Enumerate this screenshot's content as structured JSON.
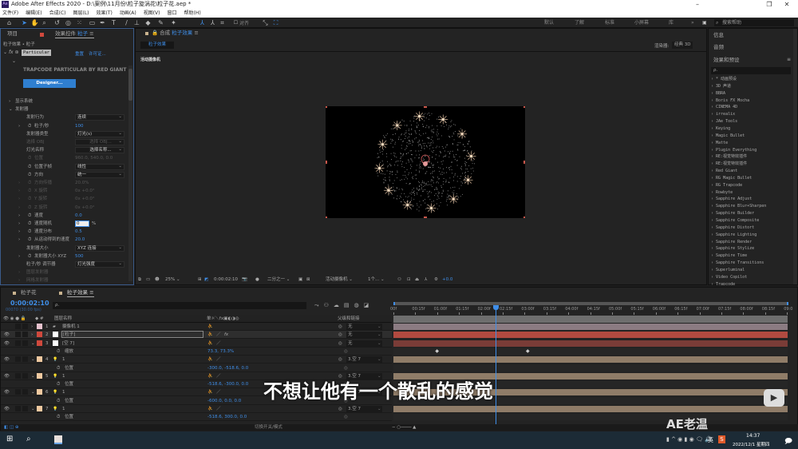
{
  "window": {
    "title": "Adobe After Effects 2020 - D:\\案例\\11月份\\粒子旋涡花\\粒子花.aep *",
    "app_icon": "Ae"
  },
  "menu": [
    "文件(F)",
    "编辑(E)",
    "合成(C)",
    "图层(L)",
    "效果(T)",
    "动画(A)",
    "视图(V)",
    "窗口",
    "帮助(H)"
  ],
  "toolbar": {
    "snap_label": "对齐",
    "workspaces": [
      "默认",
      "了解",
      "标准",
      "小屏幕",
      "库"
    ],
    "more": "»",
    "search_placeholder": "搜索帮助"
  },
  "left_panel": {
    "tab_project": "项目",
    "tab_effects": "效果控件",
    "tab_effects_layer": "粒子",
    "breadcrumb": "粒子效果 • 粒子",
    "effect_name": "Particular",
    "reset": "重置",
    "license": "许可证...",
    "banner": "TRAPCODE PARTICULAR BY RED GIANT",
    "designer": "Designer...",
    "rows": [
      {
        "label": "显示系统",
        "indent": 1,
        "twirl": "›"
      },
      {
        "label": "发射器",
        "indent": 1,
        "twirl": "⌄"
      },
      {
        "label": "发射行为",
        "indent": 2,
        "select": "连续"
      },
      {
        "label": "粒子/秒",
        "indent": 2,
        "twirl": "›",
        "stopwatch": true,
        "value": "100"
      },
      {
        "label": "发射器类型",
        "indent": 2,
        "select": "灯光(s)"
      },
      {
        "label": "选择 OBJ",
        "indent": 2,
        "disabled": true,
        "button": "选择 OBJ..."
      },
      {
        "label": "灯光名称",
        "indent": 2,
        "button": "选择名称..."
      },
      {
        "label": "位置",
        "indent": 2,
        "disabled": true,
        "stopwatch": true,
        "value": "960.0, 540.0, 0.0"
      },
      {
        "label": "位置子帧",
        "indent": 2,
        "stopwatch": true,
        "select": "线性"
      },
      {
        "label": "方向",
        "indent": 2,
        "stopwatch": true,
        "select": "统一"
      },
      {
        "label": "方向传播",
        "indent": 2,
        "twirl": "›",
        "disabled": true,
        "stopwatch": true,
        "value": "20.0%"
      },
      {
        "label": "X 旋转",
        "indent": 2,
        "twirl": "›",
        "disabled": true,
        "stopwatch": true,
        "value": "0x +0.0°"
      },
      {
        "label": "Y 旋转",
        "indent": 2,
        "twirl": "›",
        "disabled": true,
        "stopwatch": true,
        "value": "0x +0.0°"
      },
      {
        "label": "Z 旋转",
        "indent": 2,
        "twirl": "›",
        "disabled": true,
        "stopwatch": true,
        "value": "0x +0.0°"
      },
      {
        "label": "速度",
        "indent": 2,
        "twirl": "›",
        "stopwatch": true,
        "value": "0.0"
      },
      {
        "label": "速度随机",
        "indent": 2,
        "twirl": "›",
        "stopwatch": true,
        "input": "0",
        "unit": "%"
      },
      {
        "label": "速度分布",
        "indent": 2,
        "twirl": "›",
        "stopwatch": true,
        "value": "0.5"
      },
      {
        "label": "从运动得到的速度",
        "indent": 2,
        "twirl": "›",
        "stopwatch": true,
        "value": "20.0"
      },
      {
        "label": "发射器大小",
        "indent": 2,
        "select": "XYZ 连接"
      },
      {
        "label": "发射器大小 XYZ",
        "indent": 2,
        "twirl": "›",
        "stopwatch": true,
        "value": "500"
      },
      {
        "label": "粒子/秒 调节器",
        "indent": 2,
        "select": "灯光强度"
      },
      {
        "label": "图层发射器",
        "indent": 2,
        "twirl": "›",
        "disabled": true
      },
      {
        "label": "网格发射器",
        "indent": 2,
        "twirl": "›",
        "disabled": true
      }
    ]
  },
  "comp": {
    "tab_label": "合成",
    "tab_comp": "粒子效果",
    "flow_tab": "粒子效果",
    "renderer_label": "渲染器:",
    "renderer": "经典 3D",
    "view_label": "活动摄像机",
    "footer": {
      "zoom": "25%",
      "timecode": "0:00:02:10",
      "resolution": "二分之一",
      "view": "活动摄像机",
      "views": "1个...",
      "exposure": "+0.0"
    }
  },
  "right_panel": {
    "info": "信息",
    "audio": "音频",
    "effects_presets": "效果和预设",
    "search_placeholder": "ρ.",
    "items": [
      "* 动画预设",
      "3D 声道",
      "BBRA",
      "Boris FX Mocha",
      "CINEMA 4D",
      "irrealix",
      "JAe Tools",
      "Keying",
      "Magic Bullet",
      "Matte",
      "Plugin Everything",
      "RE:视觉特效插件",
      "RE:视觉特效插件",
      "Red Giant",
      "RG Magic Bullet",
      "RG Trapcode",
      "Rowbyte",
      "Sapphire Adjust",
      "Sapphire Blur+Sharpen",
      "Sapphire Builder",
      "Sapphire Composite",
      "Sapphire Distort",
      "Sapphire Lighting",
      "Sapphire Render",
      "Sapphire Stylize",
      "Sapphire Time",
      "Sapphire Transitions",
      "Superluminal",
      "Video Copilot",
      "Trapcode"
    ]
  },
  "timeline": {
    "tab_other": "粒子花",
    "tab_active": "粒子效果",
    "timecode": "0:00:02:10",
    "frames": "00070 (30.00 fps)",
    "search_placeholder": "ρ.",
    "col_name": "图层名称",
    "col_switches": "单☼＼fx▣◐◑◎",
    "col_parent": "父级和链接",
    "toggle_label": "切换开关/模式",
    "ruler": [
      "00f",
      "00:15f",
      "01:00f",
      "01:15f",
      "02:00f",
      "02:15f",
      "03:00f",
      "03:15f",
      "04:00f",
      "04:15f",
      "05:00f",
      "05:15f",
      "06:00f",
      "06:15f",
      "07:00f",
      "07:15f",
      "08:00f",
      "08:15f",
      "09:0"
    ],
    "current_time_fraction": 0.26,
    "rows": [
      {
        "type": "layer",
        "num": "1",
        "name": "摄像机 1",
        "icon": "camera",
        "color": "#e8c3cf",
        "parent": "无",
        "bar": "#8b7b82",
        "twirl": "›"
      },
      {
        "type": "layer",
        "num": "2",
        "name": "[粒子]",
        "icon": "solid",
        "color": "#d0493d",
        "parent": "无",
        "bar": "#b24a40",
        "twirl": "›",
        "selected": true,
        "fx": true
      },
      {
        "type": "layer",
        "num": "3",
        "name": "[空 7]",
        "icon": "solid",
        "color": "#d0493d",
        "parent": "无",
        "bar": "#7a3c37",
        "twirl": "⌄"
      },
      {
        "type": "prop",
        "name": "缩放",
        "value": "73.3, 73.3%",
        "keyframes": [
          0.11,
          0.34
        ]
      },
      {
        "type": "layer",
        "num": "4",
        "name": "1",
        "icon": "light",
        "color": "#f0c9a0",
        "parent": "3.空 7",
        "bar": "#8f7c68",
        "twirl": "⌄"
      },
      {
        "type": "prop",
        "name": "位置",
        "value": "-300.0, -518.6, 0.0"
      },
      {
        "type": "layer",
        "num": "5",
        "name": "1",
        "icon": "light",
        "color": "#f0c9a0",
        "parent": "3.空 7",
        "bar": "#8f7c68",
        "twirl": "⌄"
      },
      {
        "type": "prop",
        "name": "位置",
        "value": "-518.6, -300.0, 0.0"
      },
      {
        "type": "layer",
        "num": "6",
        "name": "1",
        "icon": "light",
        "color": "#f0c9a0",
        "parent": "3.空 7",
        "bar": "#8f7c68",
        "twirl": "⌄"
      },
      {
        "type": "prop",
        "name": "位置",
        "value": "-600.0, 0.0, 0.0"
      },
      {
        "type": "layer",
        "num": "7",
        "name": "1",
        "icon": "light",
        "color": "#f0c9a0",
        "parent": "3.空 7",
        "bar": "#8f7c68",
        "twirl": "⌄"
      },
      {
        "type": "prop",
        "name": "位置",
        "value": "-518.6, 300.0, 0.0"
      }
    ]
  },
  "subtitle": "不想让他有一个散乱的感觉",
  "watermark": "AE老温",
  "taskbar": {
    "time": "14:37",
    "date": "2022/12/1 星期四",
    "ime": "英"
  },
  "colors": {
    "accent": "#3f8ee8",
    "panel": "#232323",
    "taskbar": "#1c2b36"
  }
}
